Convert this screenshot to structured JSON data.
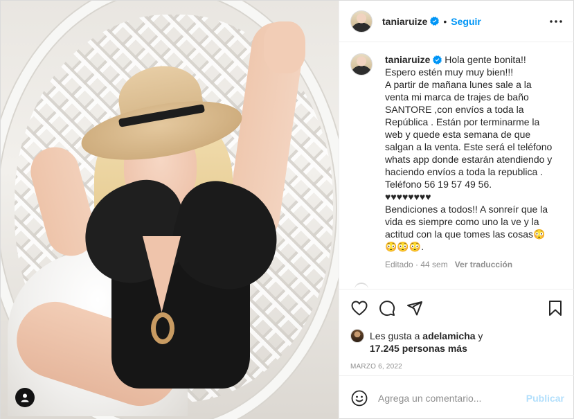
{
  "post": {
    "author": {
      "username": "taniaruize",
      "verified": true,
      "follow_label": "Seguir",
      "separator": "•"
    },
    "caption": {
      "username": "taniaruize",
      "text": "Hola gente bonita!!\nEspero estén muy muy bien!!!\nA partir de mañana lunes sale a la venta mi marca de trajes de baño SANTORE ,con envíos a toda la República . Están por terminarme la web y quede esta semana de que salgan a la venta. Este será el teléfono whats app donde estarán atendiendo y haciendo envíos a toda la republica .\nTeléfono 56 19 57 49 56.\n♥♥♥♥♥♥♥♥\nBendiciones a todos!! A sonreír que la vida es siempre como uno la ve y la actitud con la que tomes las cosas😳\n😳😳😳.",
      "edited_label": "Editado · 44 sem",
      "translate_label": "Ver traducción"
    },
    "likes": {
      "prefix": "Les gusta a ",
      "first_user": "adelamicha",
      "conjunction": " y",
      "others": "17.245 personas más"
    },
    "date": "MARZO 6, 2022",
    "comment_box": {
      "placeholder": "Agrega un comentario...",
      "post_label": "Publicar"
    },
    "colors": {
      "accent": "#0095f6",
      "publish_disabled": "#b2dffc",
      "text": "#262626",
      "muted": "#8e8e8e"
    },
    "icons": {
      "more": "more-horizontal-icon",
      "like": "heart-outline-icon",
      "comment": "comment-bubble-icon",
      "share": "paper-plane-icon",
      "save": "bookmark-icon",
      "emoji": "smiley-face-icon",
      "user_tag": "user-tag-icon"
    }
  }
}
